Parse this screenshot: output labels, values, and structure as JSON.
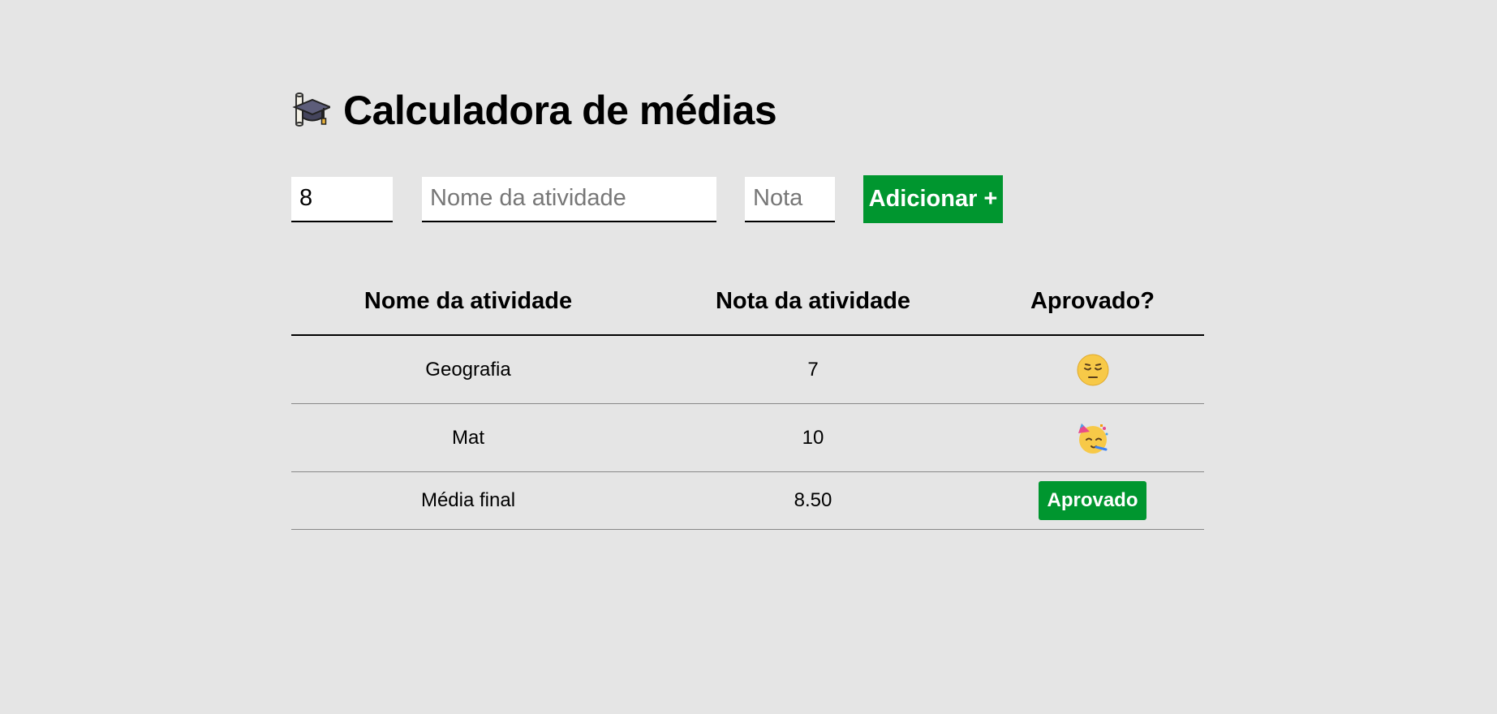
{
  "header": {
    "title": "Calculadora de médias",
    "icon": "graduation-cap-icon"
  },
  "form": {
    "number_value": "8",
    "name_placeholder": "Nome da atividade",
    "nota_placeholder": "Nota",
    "add_button_label": "Adicionar +"
  },
  "table": {
    "headers": [
      "Nome da atividade",
      "Nota da atividade",
      "Aprovado?"
    ],
    "rows": [
      {
        "name": "Geografia",
        "nota": "7",
        "status_icon": "pensive-face-icon"
      },
      {
        "name": "Mat",
        "nota": "10",
        "status_icon": "partying-face-icon"
      }
    ],
    "final": {
      "label": "Média final",
      "value": "8.50",
      "status": "Aprovado"
    }
  },
  "colors": {
    "background": "#e5e5e5",
    "accent": "#00962f"
  }
}
